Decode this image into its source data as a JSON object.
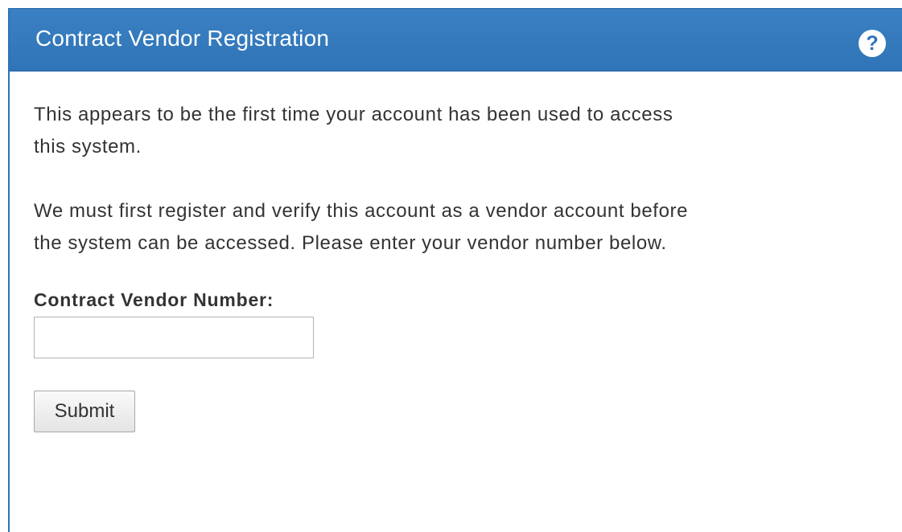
{
  "panel": {
    "title": "Contract Vendor Registration",
    "help_icon": "?"
  },
  "body": {
    "paragraph_1": "This appears to be the first time your account has been used to access this system.",
    "paragraph_2": "We must first register and verify this account as a vendor account before the system can be accessed. Please enter your vendor number below."
  },
  "form": {
    "vendor_number_label": "Contract Vendor Number:",
    "vendor_number_value": "",
    "submit_label": "Submit"
  },
  "colors": {
    "header_background": "#2f74b6",
    "header_text": "#ffffff"
  },
  "icons": {
    "help": "question-circle-icon"
  }
}
